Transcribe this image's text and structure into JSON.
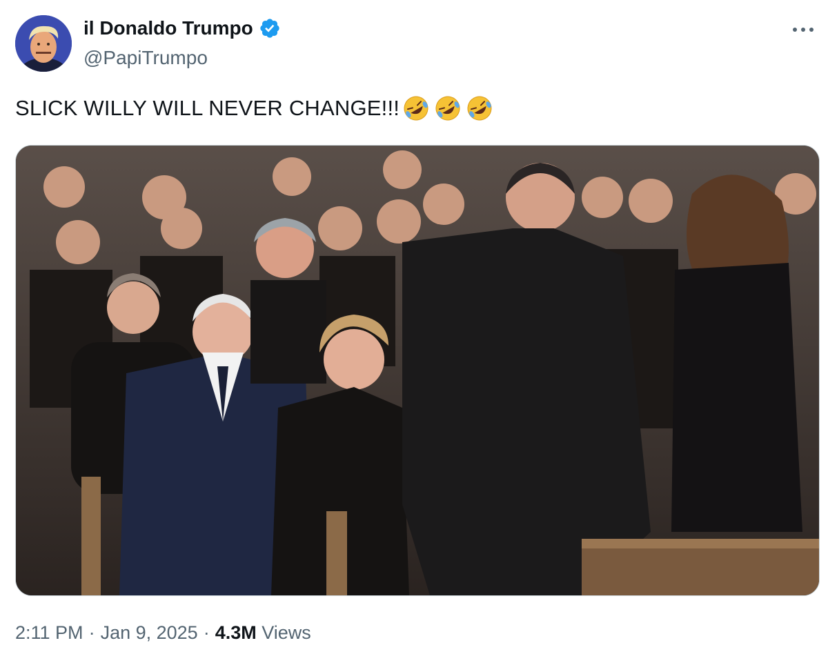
{
  "author": {
    "display_name": "il Donaldo Trumpo",
    "handle": "@PapiTrumpo",
    "verified": true,
    "avatar_icon": "avatar-photo"
  },
  "tweet": {
    "text": "SLICK WILLY WILL NEVER CHANGE!!!",
    "emojis": [
      "rolling-on-floor-laughing",
      "rolling-on-floor-laughing",
      "rolling-on-floor-laughing"
    ]
  },
  "media": {
    "kind": "photo"
  },
  "meta": {
    "time": "2:11 PM",
    "separator": "·",
    "date": "Jan 9, 2025",
    "views_count": "4.3M",
    "views_label": "Views"
  },
  "colors": {
    "verified_blue": "#1d9bf0",
    "secondary_text": "#536471",
    "primary_text": "#0f1419"
  }
}
